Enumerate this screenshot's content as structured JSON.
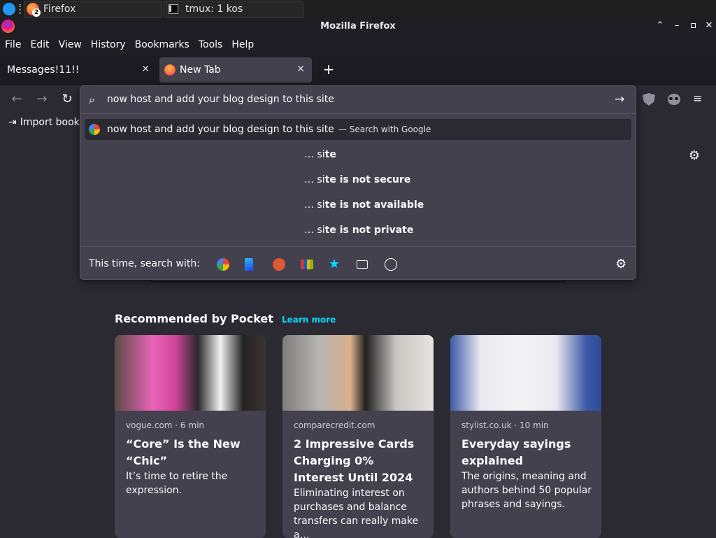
{
  "taskbar": {
    "tasks": [
      {
        "label": "Firefox",
        "badge": "2"
      },
      {
        "label": "tmux: 1 kos"
      }
    ]
  },
  "window": {
    "title": "Mozilla Firefox"
  },
  "menubar": {
    "items": [
      "File",
      "Edit",
      "View",
      "History",
      "Bookmarks",
      "Tools",
      "Help"
    ]
  },
  "tabs": [
    {
      "label": "Messages!11!!"
    },
    {
      "label": "New Tab"
    }
  ],
  "bookmarks": {
    "import_label": "Import book"
  },
  "urlbar": {
    "value": "now host and add your blog design to this site",
    "top_result": {
      "text": "now host and add your blog design to this site",
      "action": "— Search with Google"
    },
    "suggestions": [
      {
        "prefix": "… si",
        "bold": "te"
      },
      {
        "prefix": "… si",
        "bold": "te is not secure"
      },
      {
        "prefix": "… si",
        "bold": "te is not available"
      },
      {
        "prefix": "… si",
        "bold": "te is not private"
      }
    ],
    "oneoff_label": "This time, search with:",
    "engines": [
      "google-icon",
      "bing-icon",
      "duckduckgo-icon",
      "ebay-icon",
      "bookmarks-icon",
      "tabs-icon",
      "history-icon"
    ]
  },
  "pocket": {
    "heading": "Recommended by Pocket",
    "learn_more": "Learn more",
    "cards": [
      {
        "source": "vogue.com · 6 min",
        "title": "“Core” Is the New “Chic”",
        "excerpt": "It’s time to retire the expression."
      },
      {
        "source": "comparecredit.com",
        "title": "2 Impressive Cards Charging 0% Interest Until 2024",
        "excerpt": "Eliminating interest on purchases and balance transfers can really make a…"
      },
      {
        "source": "stylist.co.uk · 10 min",
        "title": "Everyday sayings explained",
        "excerpt": "The origins, meaning and authors behind 50 popular phrases and sayings."
      }
    ]
  },
  "colors": {
    "bg": "#2b2a33",
    "panel": "#42414d",
    "accent": "#00ddff"
  }
}
